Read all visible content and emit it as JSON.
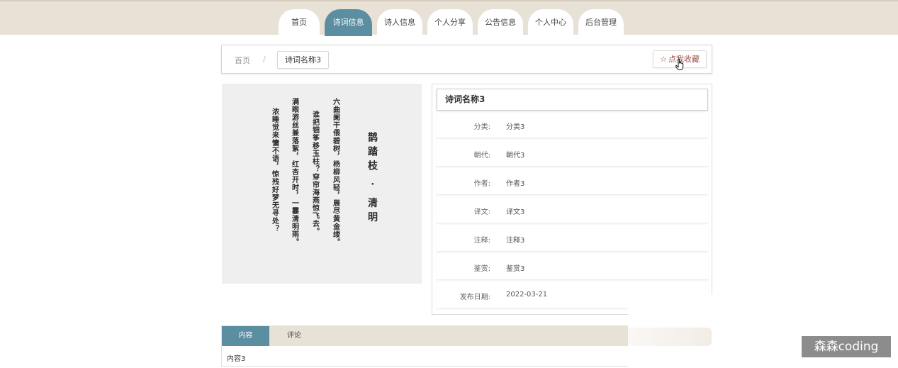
{
  "nav": {
    "items": [
      {
        "label": "首页",
        "active": false
      },
      {
        "label": "诗词信息",
        "active": true
      },
      {
        "label": "诗人信息",
        "active": false
      },
      {
        "label": "个人分享",
        "active": false
      },
      {
        "label": "公告信息",
        "active": false
      },
      {
        "label": "个人中心",
        "active": false
      },
      {
        "label": "后台管理",
        "active": false
      }
    ]
  },
  "breadcrumb": {
    "home": "首页",
    "separator": "/",
    "current": "诗词名称3"
  },
  "favorite": {
    "star": "☆",
    "label": "点我收藏"
  },
  "poem_image": {
    "title_text": "鹊踏枝 · 清明",
    "columns": [
      "鹊踏枝 · 清明",
      "六曲阑干偎碧树，杨柳风轻，展尽黄金缕。",
      "谁把钿筝移玉柱？穿帘海燕惊飞去。",
      "满眼游丝兼落絮，红杏开时，一霎清明雨。",
      "浓睡觉来慵不语，惊残好梦无寻处？"
    ]
  },
  "detail": {
    "title": "诗词名称3",
    "rows": [
      {
        "label": "分类:",
        "value": "分类3"
      },
      {
        "label": "朝代:",
        "value": "朝代3"
      },
      {
        "label": "作者:",
        "value": "作者3"
      },
      {
        "label": "译文:",
        "value": "译文3"
      },
      {
        "label": "注释:",
        "value": "注释3"
      },
      {
        "label": "鉴赏:",
        "value": "鉴赏3"
      },
      {
        "label": "发布日期:",
        "value": "2022-03-21"
      }
    ]
  },
  "tabs": {
    "items": [
      {
        "label": "内容",
        "active": true
      },
      {
        "label": "评论",
        "active": false
      }
    ],
    "content": "内容3"
  },
  "watermark": "森森coding",
  "colors": {
    "accent": "#5a8ea0",
    "nav_bg": "#e8e1d6",
    "favorite_text": "#a0524a"
  }
}
